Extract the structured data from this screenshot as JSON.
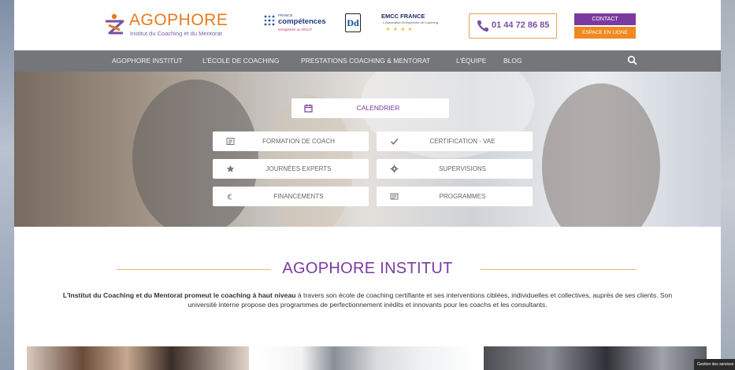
{
  "brand": {
    "name": "AGOPHORE",
    "tagline": "Institut du Coaching et du Mentorat",
    "primary_color": "#7b3aa0",
    "accent_color": "#f0891f"
  },
  "certifications": {
    "france_competences": {
      "small": "FRANCE",
      "big": "compétences",
      "sub": "enregistrée au RNCP"
    },
    "dd": "Dd",
    "emcc": {
      "title": "EMCC FRANCE",
      "sub": "L'Association Européenne de Coaching",
      "stars": "★ ★ ★ ★"
    }
  },
  "header": {
    "phone": "01 44 72 86 85",
    "contact_label": "CONTACT",
    "espace_label": "ESPACE EN LIGNE"
  },
  "nav": {
    "items": [
      "AGOPHORE INSTITUT",
      "L'ÉCOLE DE COACHING",
      "PRESTATIONS COACHING & MENTORAT",
      "L'ÉQUIPE",
      "BLOG"
    ]
  },
  "hero": {
    "calendar_label": "CALENDRIER",
    "buttons": [
      "FORMATION DE COACH",
      "CERTIFICATION - VAE",
      "JOURNÉES EXPERTS",
      "SUPERVISIONS",
      "FINANCEMENTS",
      "PROGRAMMES"
    ]
  },
  "intro": {
    "title": "AGOPHORE INSTITUT",
    "text_part1": "L'Institut du Coaching et du Mentorat promeut le coaching à haut niveau",
    "text_part2": " à travers son école de coaching certifiante et ses interventions ciblées, individuelles et collectives, auprès de ses clients. Son université interne propose des programmes de perfectionnement inédits et innovants pour les coachs et les consultants."
  },
  "cookie": {
    "label": "Gestion des services"
  }
}
